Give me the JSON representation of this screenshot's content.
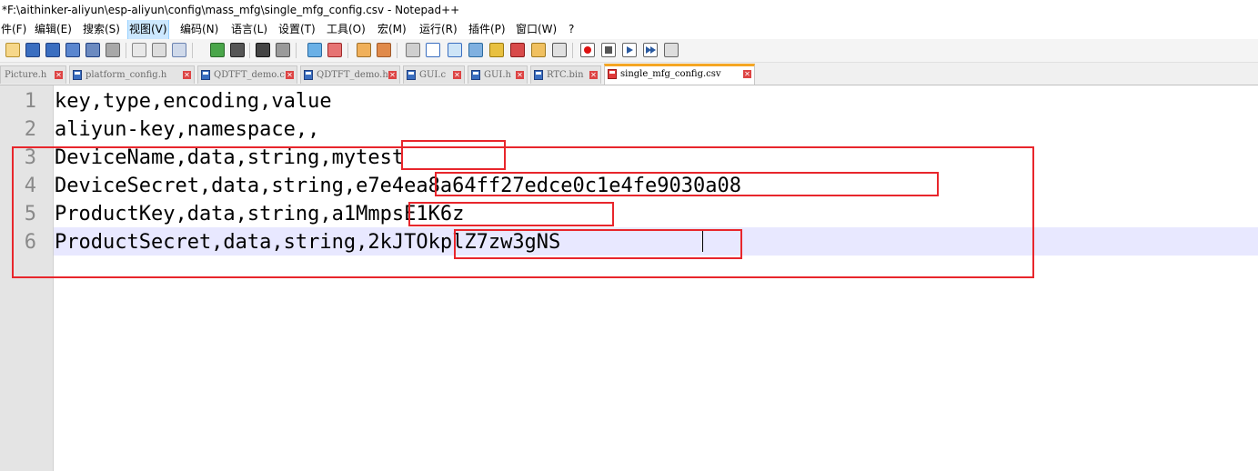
{
  "window": {
    "title": "*F:\\aithinker-aliyun\\esp-aliyun\\config\\mass_mfg\\single_mfg_config.csv - Notepad++"
  },
  "menu": {
    "items": [
      "件(F)",
      "编辑(E)",
      "搜索(S)",
      "视图(V)",
      "编码(N)",
      "语言(L)",
      "设置(T)",
      "工具(O)",
      "宏(M)",
      "运行(R)",
      "插件(P)",
      "窗口(W)",
      "?"
    ]
  },
  "toolbar": {
    "buttons": [
      "new-file-icon",
      "open-file-icon",
      "save-icon",
      "save-all-icon",
      "close-icon",
      "close-all-icon",
      "print-icon",
      "cut-icon",
      "copy-icon",
      "paste-icon",
      "undo-icon",
      "redo-icon",
      "find-icon",
      "replace-icon",
      "zoom-in-icon",
      "zoom-out-icon",
      "sync-v-icon",
      "sync-h-icon",
      "word-wrap-icon",
      "all-chars-icon",
      "indent-guide-icon",
      "udl-icon",
      "doc-map-icon",
      "function-list-icon",
      "folder-workspace-icon",
      "monitor-icon",
      "record-macro-icon",
      "stop-record-icon",
      "play-macro-icon",
      "run-macro-multiple-icon",
      "save-macro-icon"
    ]
  },
  "tabs": [
    {
      "label": "Picture.h",
      "icon": "red",
      "active": false
    },
    {
      "label": "platform_config.h",
      "icon": "blue",
      "active": false
    },
    {
      "label": "QDTFT_demo.c",
      "icon": "blue",
      "active": false
    },
    {
      "label": "QDTFT_demo.h",
      "icon": "blue",
      "active": false
    },
    {
      "label": "GUI.c",
      "icon": "blue",
      "active": false
    },
    {
      "label": "GUI.h",
      "icon": "blue",
      "active": false
    },
    {
      "label": "RTC.bin",
      "icon": "blue",
      "active": false
    },
    {
      "label": "single_mfg_config.csv",
      "icon": "red",
      "active": true
    }
  ],
  "editor": {
    "line_numbers": [
      "1",
      "2",
      "3",
      "4",
      "5",
      "6"
    ],
    "lines": [
      "key,type,encoding,value",
      "aliyun-key,namespace,,",
      "DeviceName,data,string,mytest",
      "DeviceSecret,data,string,e7e4ea8a64ff27edce0c1e4fe9030a08",
      "ProductKey,data,string,a1MmpsE1K6z",
      "ProductSecret,data,string,2kJTOkplZ7zw3gNS"
    ],
    "current_line": 6
  },
  "colors": {
    "highlight_box": "#e8262c",
    "current_line_bg": "#e8e8ff",
    "active_tab_accent": "#f5a623"
  }
}
